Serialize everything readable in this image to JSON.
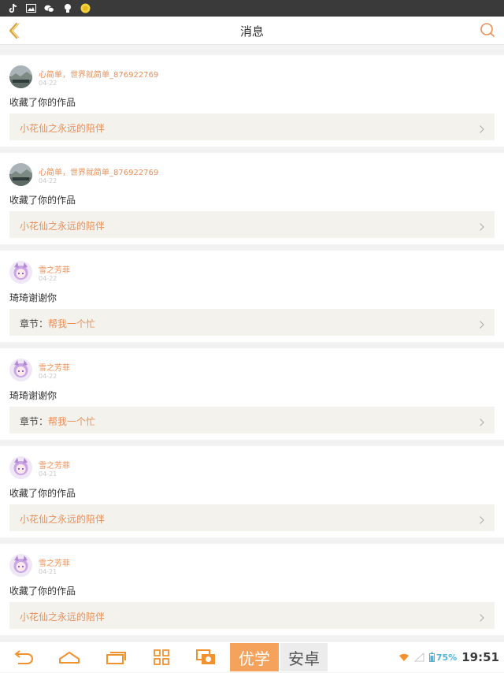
{
  "header": {
    "title": "消息"
  },
  "messages": [
    {
      "avatar": "landscape",
      "username": "心简单，世界就简单_876922769",
      "date": "04-22",
      "text": "收藏了你的作品",
      "link_prefix": "",
      "link_text": "小花仙之永远的陪伴"
    },
    {
      "avatar": "landscape",
      "username": "心简单，世界就简单_876922769",
      "date": "04-22",
      "text": "收藏了你的作品",
      "link_prefix": "",
      "link_text": "小花仙之永远的陪伴"
    },
    {
      "avatar": "anime-girl",
      "username": "雪之芳菲",
      "date": "04-22",
      "text": "琦琦谢谢你",
      "link_prefix": "章节：",
      "link_text": "帮我一个忙"
    },
    {
      "avatar": "anime-girl",
      "username": "雪之芳菲",
      "date": "04-22",
      "text": "琦琦谢谢你",
      "link_prefix": "章节：",
      "link_text": "帮我一个忙"
    },
    {
      "avatar": "anime-girl",
      "username": "雪之芳菲",
      "date": "04-21",
      "text": "收藏了你的作品",
      "link_prefix": "",
      "link_text": "小花仙之永远的陪伴"
    },
    {
      "avatar": "anime-girl",
      "username": "雪之芳菲",
      "date": "04-21",
      "text": "收藏了你的作品",
      "link_prefix": "",
      "link_text": "小花仙之永远的陪伴"
    }
  ],
  "navbar": {
    "youxue_label": "优学",
    "anzhuo_label": "安卓",
    "battery": "75%",
    "time": "19:51"
  },
  "colors": {
    "accent": "#e8905a",
    "link_bg": "#f3f2ec",
    "pill_orange": "#f5a25c",
    "pill_gray": "#ececec"
  },
  "icons": [
    "tiktok-icon",
    "image-icon",
    "wechat-icon",
    "lightbulb-icon",
    "coin-icon",
    "back-icon",
    "search-icon",
    "chevron-right-icon",
    "nav-back-icon",
    "home-icon",
    "recent-apps-icon",
    "grid-icon",
    "screenshot-icon",
    "wifi-icon",
    "signal-icon",
    "battery-icon"
  ]
}
